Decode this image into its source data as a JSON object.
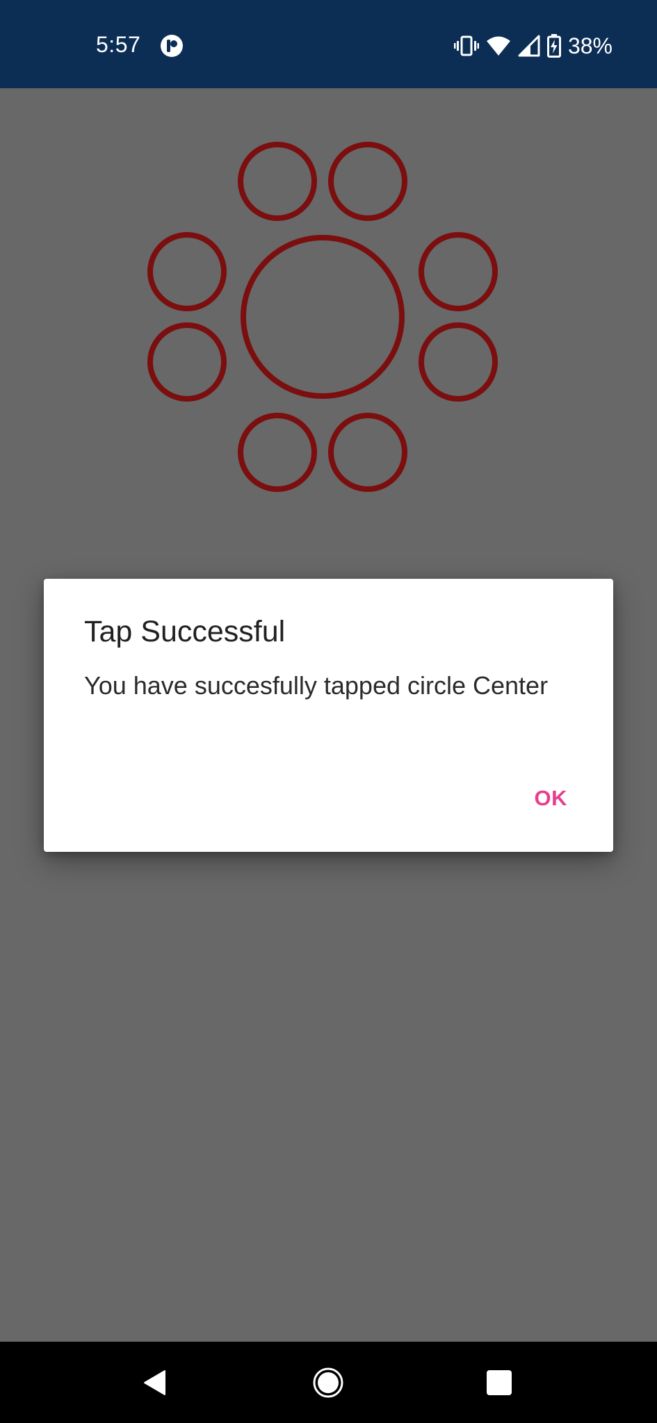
{
  "status_bar": {
    "time": "5:57",
    "battery_percent": "38%",
    "background_color": "#0c2e55",
    "icons": [
      "app-notification-icon",
      "vibrate-icon",
      "wifi-icon",
      "cellular-signal-icon",
      "battery-charging-icon"
    ]
  },
  "circles": {
    "stroke_color": "#7b0e0e",
    "items": [
      {
        "label": "Center"
      },
      {
        "label": "top-left"
      },
      {
        "label": "top-right"
      },
      {
        "label": "upper-left"
      },
      {
        "label": "upper-right"
      },
      {
        "label": "lower-left"
      },
      {
        "label": "lower-right"
      },
      {
        "label": "bottom-left"
      },
      {
        "label": "bottom-right"
      }
    ]
  },
  "dialog": {
    "title": "Tap Successful",
    "message": "You have succesfully tapped circle Center",
    "ok_label": "OK",
    "ok_color": "#e83e8c"
  },
  "nav_bar": {
    "icons": [
      "back-icon",
      "home-icon",
      "recents-icon"
    ]
  }
}
